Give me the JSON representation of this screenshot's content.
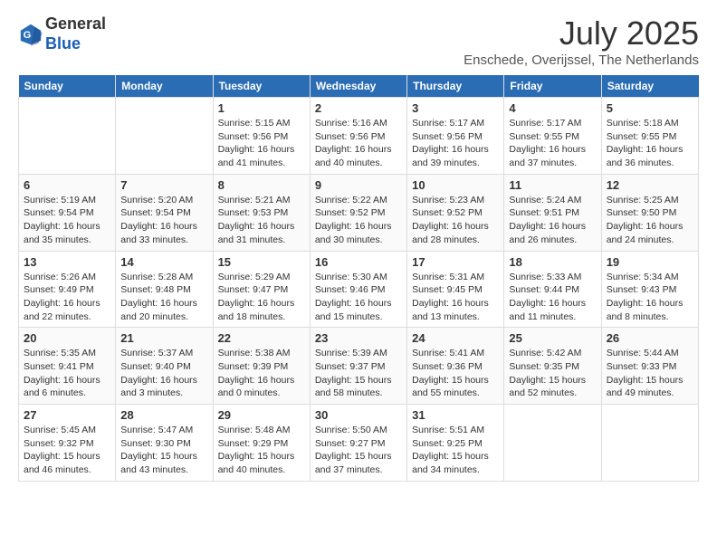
{
  "header": {
    "logo_general": "General",
    "logo_blue": "Blue",
    "month_year": "July 2025",
    "location": "Enschede, Overijssel, The Netherlands"
  },
  "days_of_week": [
    "Sunday",
    "Monday",
    "Tuesday",
    "Wednesday",
    "Thursday",
    "Friday",
    "Saturday"
  ],
  "weeks": [
    [
      {
        "day": "",
        "text": ""
      },
      {
        "day": "",
        "text": ""
      },
      {
        "day": "1",
        "text": "Sunrise: 5:15 AM\nSunset: 9:56 PM\nDaylight: 16 hours and 41 minutes."
      },
      {
        "day": "2",
        "text": "Sunrise: 5:16 AM\nSunset: 9:56 PM\nDaylight: 16 hours and 40 minutes."
      },
      {
        "day": "3",
        "text": "Sunrise: 5:17 AM\nSunset: 9:56 PM\nDaylight: 16 hours and 39 minutes."
      },
      {
        "day": "4",
        "text": "Sunrise: 5:17 AM\nSunset: 9:55 PM\nDaylight: 16 hours and 37 minutes."
      },
      {
        "day": "5",
        "text": "Sunrise: 5:18 AM\nSunset: 9:55 PM\nDaylight: 16 hours and 36 minutes."
      }
    ],
    [
      {
        "day": "6",
        "text": "Sunrise: 5:19 AM\nSunset: 9:54 PM\nDaylight: 16 hours and 35 minutes."
      },
      {
        "day": "7",
        "text": "Sunrise: 5:20 AM\nSunset: 9:54 PM\nDaylight: 16 hours and 33 minutes."
      },
      {
        "day": "8",
        "text": "Sunrise: 5:21 AM\nSunset: 9:53 PM\nDaylight: 16 hours and 31 minutes."
      },
      {
        "day": "9",
        "text": "Sunrise: 5:22 AM\nSunset: 9:52 PM\nDaylight: 16 hours and 30 minutes."
      },
      {
        "day": "10",
        "text": "Sunrise: 5:23 AM\nSunset: 9:52 PM\nDaylight: 16 hours and 28 minutes."
      },
      {
        "day": "11",
        "text": "Sunrise: 5:24 AM\nSunset: 9:51 PM\nDaylight: 16 hours and 26 minutes."
      },
      {
        "day": "12",
        "text": "Sunrise: 5:25 AM\nSunset: 9:50 PM\nDaylight: 16 hours and 24 minutes."
      }
    ],
    [
      {
        "day": "13",
        "text": "Sunrise: 5:26 AM\nSunset: 9:49 PM\nDaylight: 16 hours and 22 minutes."
      },
      {
        "day": "14",
        "text": "Sunrise: 5:28 AM\nSunset: 9:48 PM\nDaylight: 16 hours and 20 minutes."
      },
      {
        "day": "15",
        "text": "Sunrise: 5:29 AM\nSunset: 9:47 PM\nDaylight: 16 hours and 18 minutes."
      },
      {
        "day": "16",
        "text": "Sunrise: 5:30 AM\nSunset: 9:46 PM\nDaylight: 16 hours and 15 minutes."
      },
      {
        "day": "17",
        "text": "Sunrise: 5:31 AM\nSunset: 9:45 PM\nDaylight: 16 hours and 13 minutes."
      },
      {
        "day": "18",
        "text": "Sunrise: 5:33 AM\nSunset: 9:44 PM\nDaylight: 16 hours and 11 minutes."
      },
      {
        "day": "19",
        "text": "Sunrise: 5:34 AM\nSunset: 9:43 PM\nDaylight: 16 hours and 8 minutes."
      }
    ],
    [
      {
        "day": "20",
        "text": "Sunrise: 5:35 AM\nSunset: 9:41 PM\nDaylight: 16 hours and 6 minutes."
      },
      {
        "day": "21",
        "text": "Sunrise: 5:37 AM\nSunset: 9:40 PM\nDaylight: 16 hours and 3 minutes."
      },
      {
        "day": "22",
        "text": "Sunrise: 5:38 AM\nSunset: 9:39 PM\nDaylight: 16 hours and 0 minutes."
      },
      {
        "day": "23",
        "text": "Sunrise: 5:39 AM\nSunset: 9:37 PM\nDaylight: 15 hours and 58 minutes."
      },
      {
        "day": "24",
        "text": "Sunrise: 5:41 AM\nSunset: 9:36 PM\nDaylight: 15 hours and 55 minutes."
      },
      {
        "day": "25",
        "text": "Sunrise: 5:42 AM\nSunset: 9:35 PM\nDaylight: 15 hours and 52 minutes."
      },
      {
        "day": "26",
        "text": "Sunrise: 5:44 AM\nSunset: 9:33 PM\nDaylight: 15 hours and 49 minutes."
      }
    ],
    [
      {
        "day": "27",
        "text": "Sunrise: 5:45 AM\nSunset: 9:32 PM\nDaylight: 15 hours and 46 minutes."
      },
      {
        "day": "28",
        "text": "Sunrise: 5:47 AM\nSunset: 9:30 PM\nDaylight: 15 hours and 43 minutes."
      },
      {
        "day": "29",
        "text": "Sunrise: 5:48 AM\nSunset: 9:29 PM\nDaylight: 15 hours and 40 minutes."
      },
      {
        "day": "30",
        "text": "Sunrise: 5:50 AM\nSunset: 9:27 PM\nDaylight: 15 hours and 37 minutes."
      },
      {
        "day": "31",
        "text": "Sunrise: 5:51 AM\nSunset: 9:25 PM\nDaylight: 15 hours and 34 minutes."
      },
      {
        "day": "",
        "text": ""
      },
      {
        "day": "",
        "text": ""
      }
    ]
  ]
}
